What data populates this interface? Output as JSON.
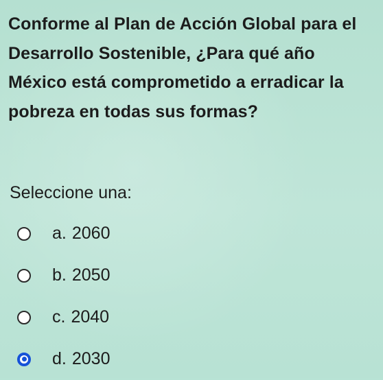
{
  "question": {
    "text": "Conforme al Plan de Acción Global para el Desarrollo Sostenible, ¿Para qué año México está comprometido a erradicar la pobreza en todas sus formas?"
  },
  "prompt": "Seleccione una:",
  "options": [
    {
      "letter": "a.",
      "value": "2060",
      "selected": false
    },
    {
      "letter": "b.",
      "value": "2050",
      "selected": false
    },
    {
      "letter": "c.",
      "value": "2040",
      "selected": false
    },
    {
      "letter": "d.",
      "value": "2030",
      "selected": true
    }
  ],
  "colors": {
    "background": "#b8e3d5",
    "selected_radio": "#1652d8",
    "text": "#1c1c1c"
  }
}
